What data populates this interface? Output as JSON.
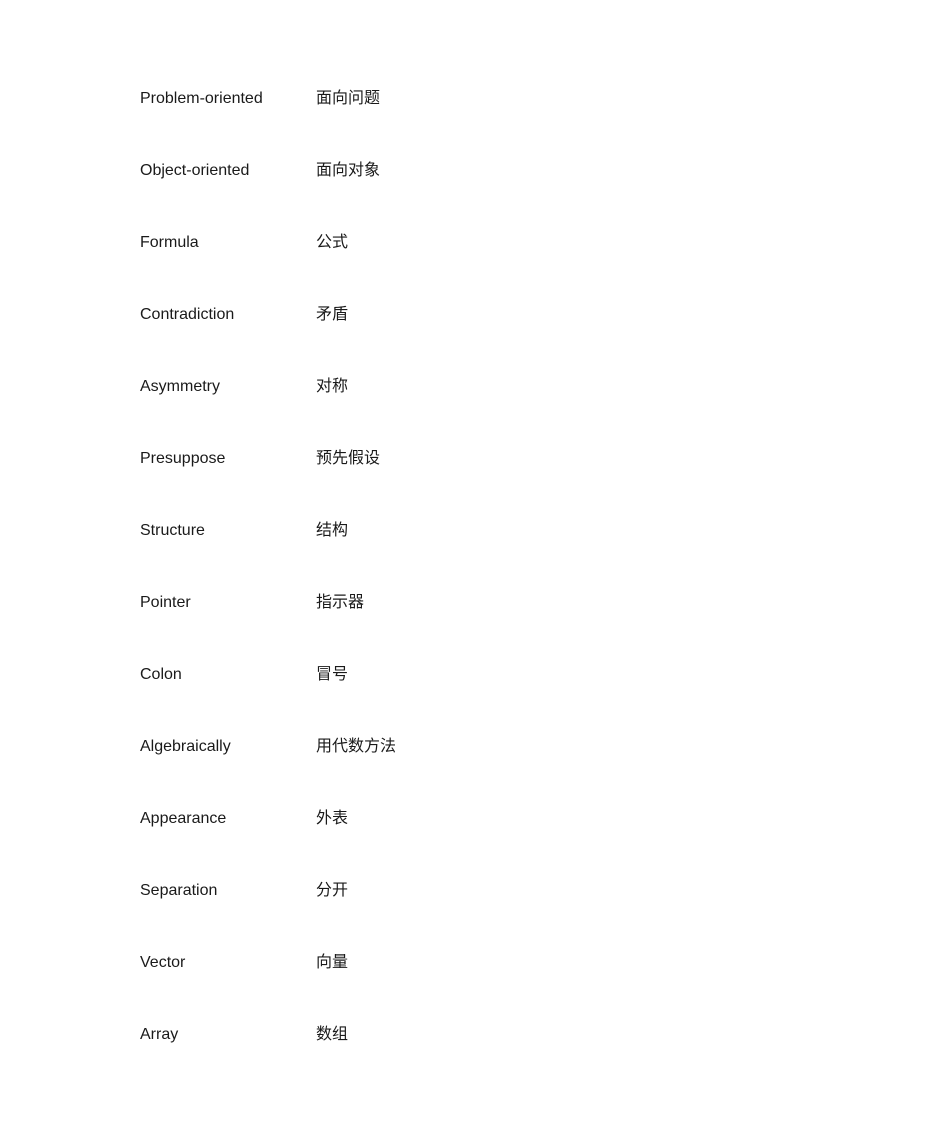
{
  "rows": [
    {
      "en": "Problem-oriented",
      "zh": "面向问题"
    },
    {
      "en": "Object-oriented",
      "zh": "面向对象"
    },
    {
      "en": "Formula",
      "zh": "公式"
    },
    {
      "en": "Contradiction",
      "zh": "矛盾"
    },
    {
      "en": "Asymmetry",
      "zh": "对称"
    },
    {
      "en": "Presuppose",
      "zh": "预先假设"
    },
    {
      "en": "Structure",
      "zh": "结构"
    },
    {
      "en": "Pointer",
      "zh": "指示器"
    },
    {
      "en": "Colon",
      "zh": "冒号"
    },
    {
      "en": "Algebraically",
      "zh": "用代数方法"
    },
    {
      "en": "Appearance",
      "zh": "外表"
    },
    {
      "en": "Separation",
      "zh": "分开"
    },
    {
      "en": "Vector",
      "zh": "向量"
    },
    {
      "en": "Array",
      "zh": "数组"
    }
  ]
}
